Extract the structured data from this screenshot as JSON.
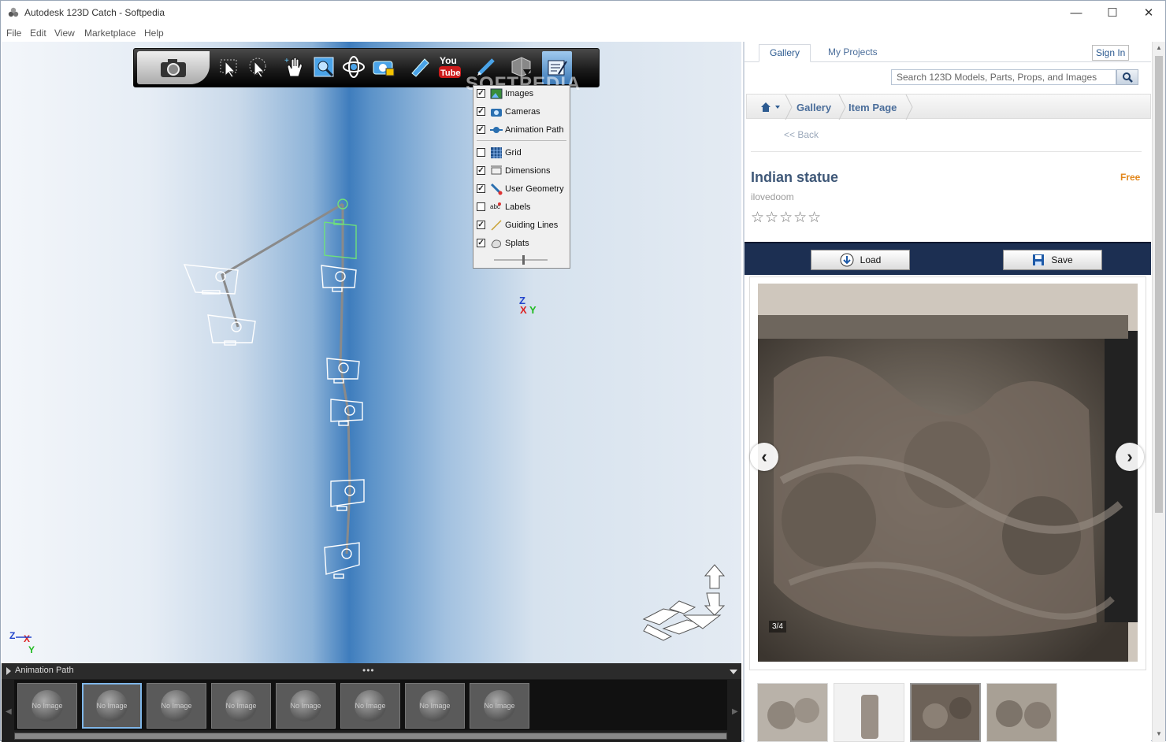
{
  "window": {
    "title": "Autodesk 123D Catch - Softpedia"
  },
  "menu": [
    "File",
    "Edit",
    "View",
    "Marketplace",
    "Help"
  ],
  "watermark": "SOFTPEDIA",
  "toolbar": {
    "icons": [
      "camera-icon",
      "select-icon",
      "select-add-icon",
      "pan-icon",
      "zoom-window-icon",
      "orbit-icon",
      "camera-lock-icon",
      "measure-icon",
      "youtube-icon",
      "pen-icon",
      "mesh-export-icon",
      "display-options-icon"
    ]
  },
  "view_menu": {
    "items": [
      {
        "label": "Images",
        "checked": true
      },
      {
        "label": "Cameras",
        "checked": true
      },
      {
        "label": "Animation Path",
        "checked": true
      },
      {
        "label": "Grid",
        "checked": false
      },
      {
        "label": "Dimensions",
        "checked": true
      },
      {
        "label": "User Geometry",
        "checked": true
      },
      {
        "label": "Labels",
        "checked": false
      },
      {
        "label": "Guiding Lines",
        "checked": true
      },
      {
        "label": "Splats",
        "checked": true
      }
    ],
    "splat_size_level": 0.55
  },
  "axis_labels": {
    "z": "Z",
    "x": "X",
    "y": "Y"
  },
  "animation_panel": {
    "title": "Animation Path",
    "thumbnail_text": "No Image",
    "thumbnail_count": 8,
    "selected_index": 1
  },
  "right_panel": {
    "tabs": [
      "Gallery",
      "My Projects"
    ],
    "sign_in": "Sign In",
    "search_placeholder": "Search 123D Models, Parts, Props, and Images",
    "breadcrumb": [
      "Gallery",
      "Item Page"
    ],
    "back": "<< Back",
    "item_title": "Indian statue",
    "price": "Free",
    "author": "ilovedoom",
    "rating": "☆☆☆☆☆",
    "load_label": "Load",
    "save_label": "Save",
    "image_counter": "3/4",
    "thumbnails": 4
  },
  "colors": {
    "accent": "#2d5b91",
    "action_bar": "#1c2f52",
    "price": "#e2861a"
  }
}
